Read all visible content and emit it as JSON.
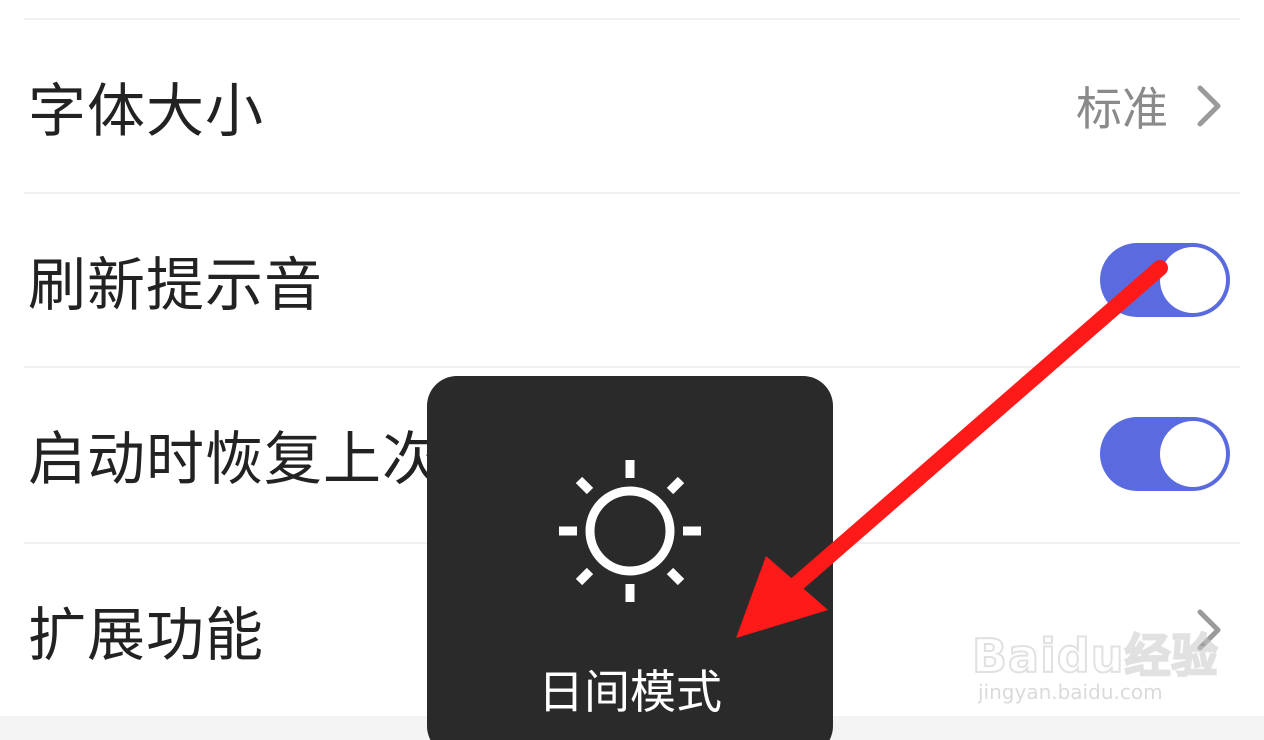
{
  "settings": {
    "rows": [
      {
        "label": "字体大小",
        "value": "标准",
        "control": "chevron"
      },
      {
        "label": "刷新提示音",
        "control": "toggle",
        "on": true
      },
      {
        "label": "启动时恢复上次浏览的网页",
        "control": "toggle",
        "on": true
      },
      {
        "label": "扩展功能",
        "control": "chevron"
      }
    ]
  },
  "toast": {
    "icon": "sun-icon",
    "label": "日间模式"
  },
  "annotation": {
    "icon": "red-arrow-icon",
    "color": "#ff1a1a"
  },
  "watermark": {
    "logo": "Baidu经验",
    "url": "jingyan.baidu.com"
  },
  "colors": {
    "toggle_on": "#5a6be0",
    "toast_bg": "#2a2a2a",
    "label_text": "#222222",
    "value_text": "#8a8a8a"
  }
}
